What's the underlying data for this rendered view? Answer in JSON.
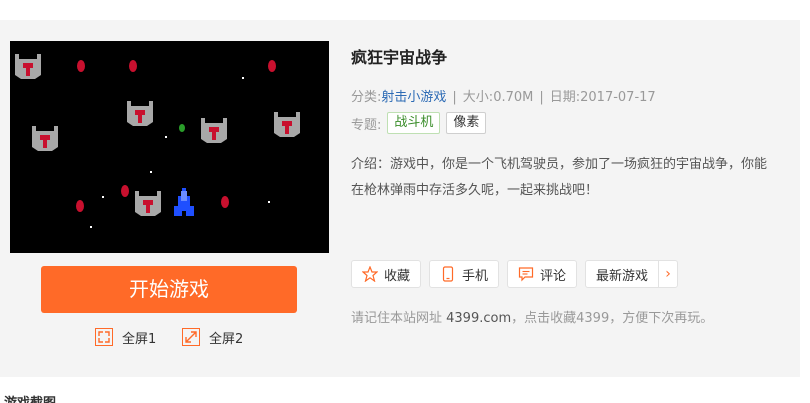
{
  "game": {
    "title": "疯狂宇宙战争",
    "category_label": "分类:",
    "category": "射击小游戏",
    "size_label": "大小:",
    "size": "0.70M",
    "date_label": "日期:",
    "date": "2017-07-17",
    "separator": "|",
    "topic_label": "专题:",
    "topics": [
      "战斗机",
      "像素"
    ],
    "intro": "介绍：游戏中，你是一个飞机驾驶员，参加了一场疯狂的宇宙战争，你能在枪林弹雨中存活多久呢，一起来挑战吧！"
  },
  "player": {
    "start_label": "开始游戏",
    "fullscreen1_label": "全屏1",
    "fullscreen2_label": "全屏2"
  },
  "actions": {
    "favorite_label": "收藏",
    "mobile_label": "手机",
    "comment_label": "评论",
    "latest_label": "最新游戏",
    "more_arrow": "›"
  },
  "remember": {
    "text_before": "请记住本站网址 ",
    "site": "4399.com",
    "text_middle": "，点击收藏4399",
    "text_after": "，方便下次再玩。"
  },
  "section_heading_cut": "游戏截图",
  "colors": {
    "accent": "#ff6a28",
    "link": "#2d6bb5",
    "tag_green": "#3a8d2a"
  }
}
